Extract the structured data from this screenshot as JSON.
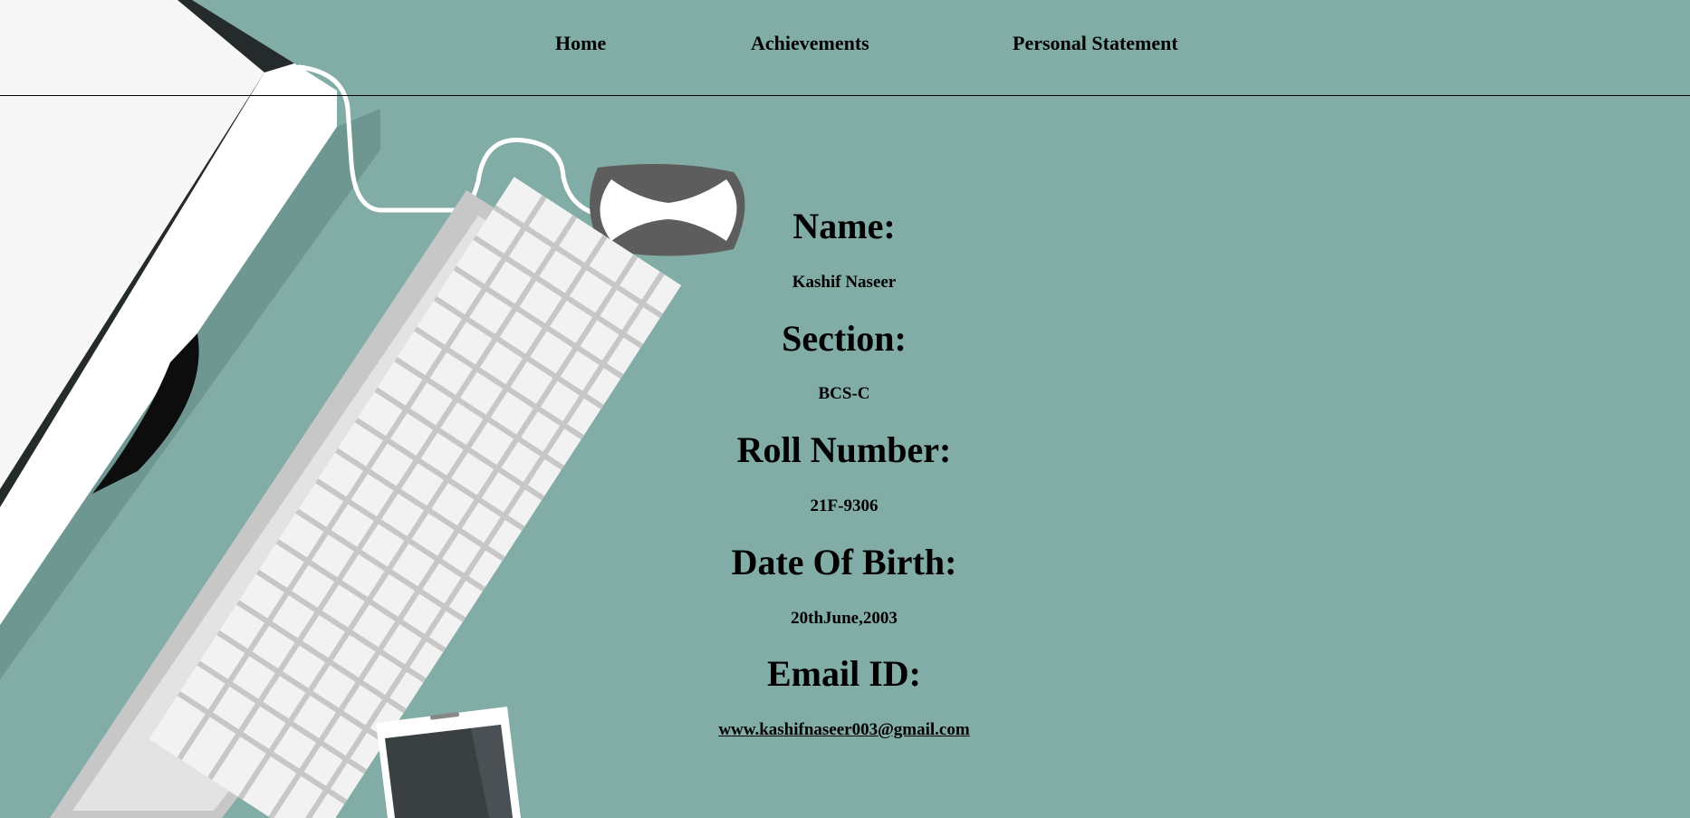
{
  "nav": {
    "home": "Home",
    "achievements": "Achievements",
    "personal_statement": "Personal Statement"
  },
  "profile": {
    "name_label": "Name:",
    "name_value": "Kashif Naseer",
    "section_label": "Section:",
    "section_value": "BCS-C",
    "roll_label": "Roll Number:",
    "roll_value": "21F-9306",
    "dob_label": "Date Of Birth:",
    "dob_value": "20thJune,2003",
    "email_label": "Email ID:",
    "email_value": "www.kashifnaseer003@gmail.com"
  },
  "colors": {
    "background": "#82aca6",
    "text": "#000000"
  },
  "icons": {
    "background": "desk-illustration",
    "monitor": "monitor-icon",
    "keyboard": "keyboard-icon",
    "mouse": "mouse-icon",
    "phone": "phone-icon"
  }
}
